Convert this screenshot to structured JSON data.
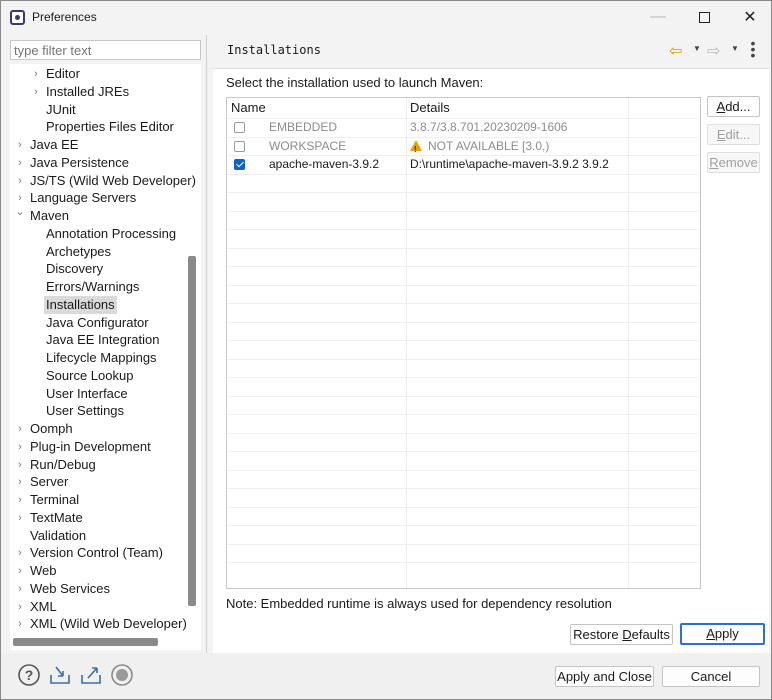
{
  "window": {
    "title": "Preferences"
  },
  "filter": {
    "placeholder": "type filter text"
  },
  "tree": [
    {
      "label": "Editor",
      "level": 2,
      "expandable": true
    },
    {
      "label": "Installed JREs",
      "level": 2,
      "expandable": true
    },
    {
      "label": "JUnit",
      "level": 2,
      "expandable": false
    },
    {
      "label": "Properties Files Editor",
      "level": 2,
      "expandable": false
    },
    {
      "label": "Java EE",
      "level": 1,
      "expandable": true
    },
    {
      "label": "Java Persistence",
      "level": 1,
      "expandable": true
    },
    {
      "label": "JS/TS (Wild Web Developer)",
      "level": 1,
      "expandable": true
    },
    {
      "label": "Language Servers",
      "level": 1,
      "expandable": true
    },
    {
      "label": "Maven",
      "level": 1,
      "expandable": true,
      "expanded": true
    },
    {
      "label": "Annotation Processing",
      "level": 2,
      "expandable": false
    },
    {
      "label": "Archetypes",
      "level": 2,
      "expandable": false
    },
    {
      "label": "Discovery",
      "level": 2,
      "expandable": false
    },
    {
      "label": "Errors/Warnings",
      "level": 2,
      "expandable": false
    },
    {
      "label": "Installations",
      "level": 2,
      "expandable": false,
      "selected": true
    },
    {
      "label": "Java Configurator",
      "level": 2,
      "expandable": false
    },
    {
      "label": "Java EE Integration",
      "level": 2,
      "expandable": false
    },
    {
      "label": "Lifecycle Mappings",
      "level": 2,
      "expandable": false
    },
    {
      "label": "Source Lookup",
      "level": 2,
      "expandable": false
    },
    {
      "label": "User Interface",
      "level": 2,
      "expandable": false
    },
    {
      "label": "User Settings",
      "level": 2,
      "expandable": false
    },
    {
      "label": "Oomph",
      "level": 1,
      "expandable": true
    },
    {
      "label": "Plug-in Development",
      "level": 1,
      "expandable": true
    },
    {
      "label": "Run/Debug",
      "level": 1,
      "expandable": true
    },
    {
      "label": "Server",
      "level": 1,
      "expandable": true
    },
    {
      "label": "Terminal",
      "level": 1,
      "expandable": true
    },
    {
      "label": "TextMate",
      "level": 1,
      "expandable": true
    },
    {
      "label": "Validation",
      "level": 1,
      "expandable": false
    },
    {
      "label": "Version Control (Team)",
      "level": 1,
      "expandable": true
    },
    {
      "label": "Web",
      "level": 1,
      "expandable": true
    },
    {
      "label": "Web Services",
      "level": 1,
      "expandable": true
    },
    {
      "label": "XML",
      "level": 1,
      "expandable": true
    },
    {
      "label": "XML (Wild Web Developer)",
      "level": 1,
      "expandable": true
    }
  ],
  "page": {
    "title": "Installations",
    "select_label": "Select the installation used to launch Maven:",
    "table": {
      "headers": [
        "Name",
        "Details"
      ],
      "rows": [
        {
          "name": "EMBEDDED",
          "details": "3.8.7/3.8.701.20230209-1606",
          "checked": false,
          "dimmed": true,
          "warning": false
        },
        {
          "name": "WORKSPACE",
          "details": "NOT AVAILABLE [3.0,)",
          "checked": false,
          "dimmed": true,
          "warning": true
        },
        {
          "name": "apache-maven-3.9.2",
          "details": "D:\\runtime\\apache-maven-3.9.2 3.9.2",
          "checked": true,
          "dimmed": false,
          "warning": false
        }
      ]
    },
    "buttons": {
      "add": "Add...",
      "edit": "Edit...",
      "remove": "Remove"
    },
    "note": "Note: Embedded runtime is always used for dependency resolution",
    "restore_defaults": "Restore Defaults",
    "apply": "Apply"
  },
  "footer": {
    "apply_and_close": "Apply and Close",
    "cancel": "Cancel"
  },
  "colors": {
    "accent": "#0a64c8",
    "warning": "#e6a400",
    "selection": "#dadada"
  }
}
